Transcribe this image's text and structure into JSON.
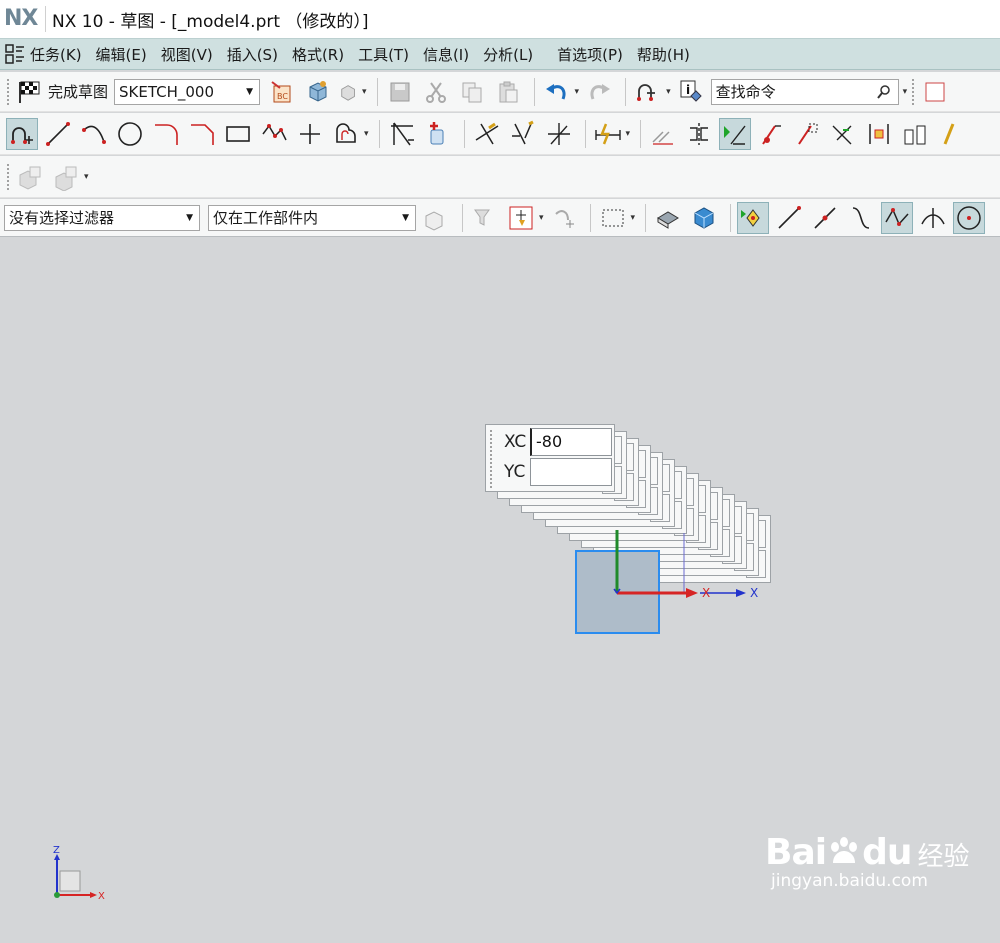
{
  "window": {
    "logo": "NX",
    "title": "NX 10 - 草图 - [_model4.prt （修改的）]"
  },
  "menubar": {
    "items": [
      "任务(K)",
      "编辑(E)",
      "视图(V)",
      "插入(S)",
      "格式(R)",
      "工具(T)",
      "信息(I)",
      "分析(L)",
      "首选项(P)",
      "帮助(H)"
    ]
  },
  "toolbar_sketch": {
    "finish_label": "完成草图",
    "sketch_name": "SKETCH_000",
    "search_placeholder": "查找命令"
  },
  "selection_bar": {
    "filter": "没有选择过滤器",
    "scope": "仅在工作部件内"
  },
  "coordinate_input": {
    "xc_label": "XC",
    "xc_value": "-80",
    "yc_label": "YC",
    "yc_value": ""
  },
  "axes": {
    "x_label": "X",
    "z_label": "Z"
  },
  "colors": {
    "menubar_bg": "#cfe0e0",
    "canvas_bg": "#d4d6d8",
    "x_axis": "#d62424",
    "y_axis": "#1f8a2a",
    "z_axis": "#2233cc",
    "sketch_plane": "#aebcc9",
    "sketch_plane_border": "#2a8cef"
  },
  "watermark": {
    "brand": "Bai",
    "brand2": "du",
    "cn": "经验",
    "url": "jingyan.baidu.com"
  }
}
